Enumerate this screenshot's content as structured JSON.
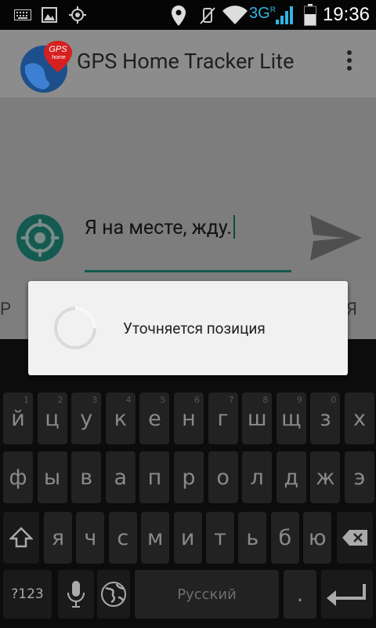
{
  "status_bar": {
    "time": "19:36",
    "network": "3G",
    "roaming": "R",
    "icons": [
      "keyboard-icon",
      "image-icon",
      "gps-target-icon",
      "location-pin-icon",
      "mute-icon",
      "wifi-icon",
      "signal-icon",
      "battery-icon"
    ]
  },
  "action_bar": {
    "title": "GPS Home Tracker Lite",
    "logo_text_top": "GPS",
    "logo_text_bottom": "home",
    "overflow_icon": "overflow-menu-icon"
  },
  "message": {
    "text": "Я на месте, жду.",
    "send_icon": "send-icon",
    "locate_icon": "crosshair-icon"
  },
  "suggestions": {
    "left": "Р",
    "right": "Я"
  },
  "dialog": {
    "text": "Уточняется позиция"
  },
  "keyboard": {
    "row1": [
      {
        "k": "й",
        "h": "1"
      },
      {
        "k": "ц",
        "h": "2"
      },
      {
        "k": "у",
        "h": "3"
      },
      {
        "k": "к",
        "h": "4"
      },
      {
        "k": "е",
        "h": "5"
      },
      {
        "k": "н",
        "h": "6"
      },
      {
        "k": "г",
        "h": "7"
      },
      {
        "k": "ш",
        "h": "8"
      },
      {
        "k": "щ",
        "h": "9"
      },
      {
        "k": "з",
        "h": "0"
      },
      {
        "k": "х",
        "h": ""
      }
    ],
    "row2": [
      "ф",
      "ы",
      "в",
      "а",
      "п",
      "р",
      "о",
      "л",
      "д",
      "ж",
      "э"
    ],
    "row3": [
      "я",
      "ч",
      "с",
      "м",
      "и",
      "т",
      "ь",
      "б",
      "ю"
    ],
    "symbols_label": "?123",
    "space_label": "Русский",
    "period_label": ".",
    "colors": {
      "background": "#0c0c0c",
      "key": "#222222",
      "key_text": "#8a8a8a"
    }
  },
  "colors": {
    "accent": "#145a50",
    "dialog": "#f1f1f1",
    "status_3g": "#33b5e5"
  }
}
